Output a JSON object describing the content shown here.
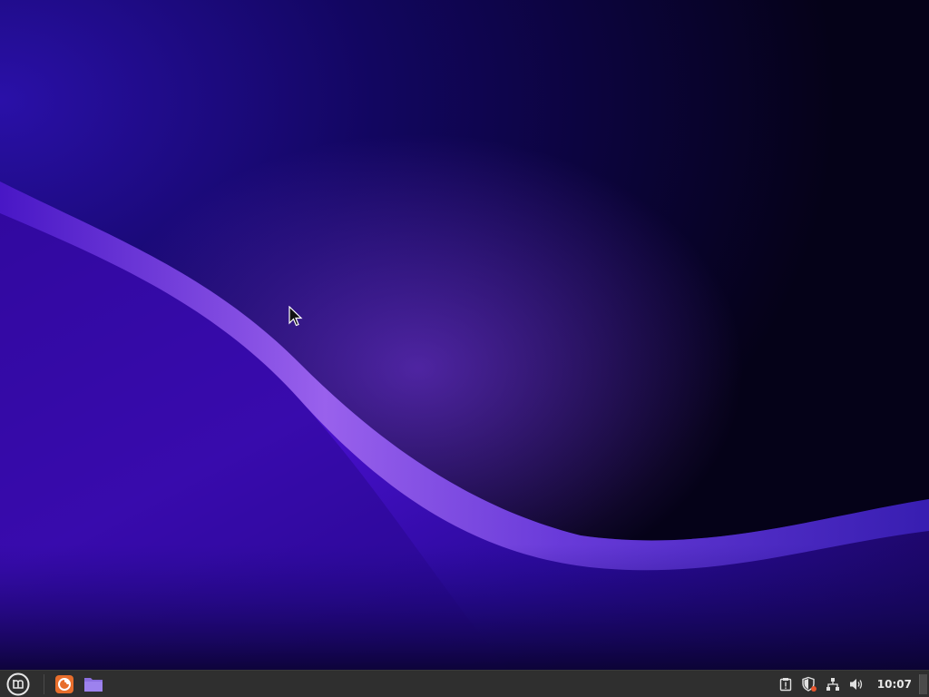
{
  "desktop": {
    "wallpaper": "purple-wave-wallpaper",
    "colors": {
      "base": "#070320",
      "deep_violet": "#3a08b8",
      "wave_highlight": "#b37cf5",
      "indigo": "#1a0a78"
    }
  },
  "panel": {
    "menu_icon": "linux-mint-logo-icon",
    "launchers": [
      {
        "name": "firefox-launcher",
        "icon": "firefox-icon"
      },
      {
        "name": "file-manager-launcher",
        "icon": "folder-icon"
      }
    ],
    "tray": {
      "icons": [
        "clipboard-alert-icon",
        "update-manager-shield-icon",
        "network-icon",
        "volume-icon"
      ],
      "clock": "10:07"
    }
  }
}
